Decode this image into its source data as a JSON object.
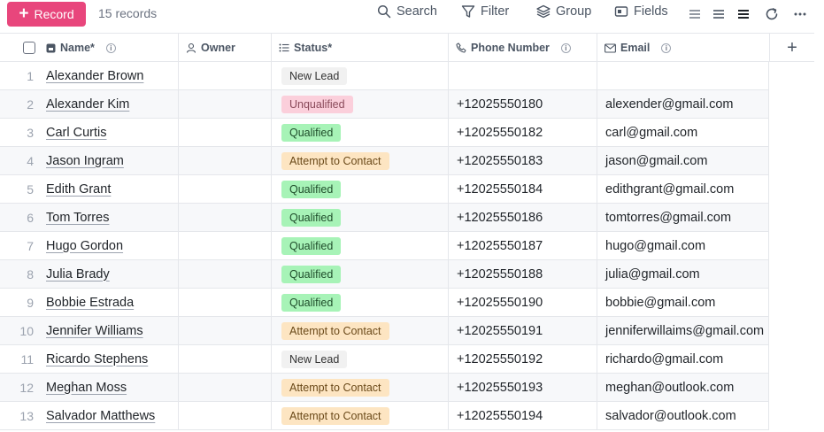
{
  "toolbar": {
    "record_label": "Record",
    "record_count": "15 records",
    "search_label": "Search",
    "filter_label": "Filter",
    "group_label": "Group",
    "fields_label": "Fields"
  },
  "columns": {
    "name": "Name*",
    "owner": "Owner",
    "status": "Status*",
    "phone": "Phone Number",
    "email": "Email"
  },
  "status_styles": {
    "New Lead": {
      "bg": "#f1f1f1",
      "fg": "#333333"
    },
    "Unqualified": {
      "bg": "#fbcfdb",
      "fg": "#8a4a5a"
    },
    "Qualified": {
      "bg": "#a7f3b7",
      "fg": "#1f4d2b"
    },
    "Attempt to Contact": {
      "bg": "#fde5c2",
      "fg": "#6b4a1a"
    }
  },
  "rows": [
    {
      "num": "1",
      "name": "Alexander Brown",
      "owner": "",
      "status": "New Lead",
      "phone": "",
      "email": ""
    },
    {
      "num": "2",
      "name": "Alexander Kim",
      "owner": "",
      "status": "Unqualified",
      "phone": "+12025550180",
      "email": "alexender@gmail.com"
    },
    {
      "num": "3",
      "name": "Carl Curtis",
      "owner": "",
      "status": "Qualified",
      "phone": "+12025550182",
      "email": "carl@gmail.com"
    },
    {
      "num": "4",
      "name": "Jason Ingram",
      "owner": "",
      "status": "Attempt to Contact",
      "phone": "+12025550183",
      "email": "jason@gmail.com"
    },
    {
      "num": "5",
      "name": "Edith Grant",
      "owner": "",
      "status": "Qualified",
      "phone": "+12025550184",
      "email": "edithgrant@gmail.com"
    },
    {
      "num": "6",
      "name": "Tom Torres",
      "owner": "",
      "status": "Qualified",
      "phone": "+12025550186",
      "email": "tomtorres@gmail.com"
    },
    {
      "num": "7",
      "name": "Hugo Gordon",
      "owner": "",
      "status": "Qualified",
      "phone": "+12025550187",
      "email": "hugo@gmail.com"
    },
    {
      "num": "8",
      "name": "Julia Brady",
      "owner": "",
      "status": "Qualified",
      "phone": "+12025550188",
      "email": "julia@gmail.com"
    },
    {
      "num": "9",
      "name": "Bobbie Estrada",
      "owner": "",
      "status": "Qualified",
      "phone": "+12025550190",
      "email": "bobbie@gmail.com"
    },
    {
      "num": "10",
      "name": "Jennifer Williams",
      "owner": "",
      "status": "Attempt to Contact",
      "phone": "+12025550191",
      "email": "jenniferwillaims@gmail.com"
    },
    {
      "num": "11",
      "name": "Ricardo Stephens",
      "owner": "",
      "status": "New Lead",
      "phone": "+12025550192",
      "email": "richardo@gmail.com"
    },
    {
      "num": "12",
      "name": "Meghan Moss",
      "owner": "",
      "status": "Attempt to Contact",
      "phone": "+12025550193",
      "email": "meghan@outlook.com"
    },
    {
      "num": "13",
      "name": "Salvador Matthews",
      "owner": "",
      "status": "Attempt to Contact",
      "phone": "+12025550194",
      "email": "salvador@outlook.com"
    }
  ]
}
